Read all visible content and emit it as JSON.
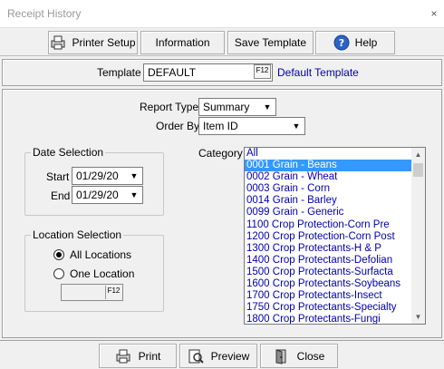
{
  "window": {
    "title": "Receipt History",
    "close_glyph": "×"
  },
  "toolbar": {
    "printer_setup_label": "Printer Setup",
    "information_label": "Information",
    "save_template_label": "Save Template",
    "help_label": "Help"
  },
  "template": {
    "label": "Template",
    "value": "DEFAULT",
    "lookup_key": "F12",
    "description": "Default Template"
  },
  "report": {
    "type_label": "Report Type",
    "type_value": "Summary",
    "order_label": "Order By",
    "order_value": "Item ID"
  },
  "date_selection": {
    "title": "Date Selection",
    "start_label": "Start",
    "start_value": "01/29/20",
    "end_label": "End",
    "end_value": "01/29/20"
  },
  "location_selection": {
    "title": "Location Selection",
    "all_label": "All Locations",
    "one_label": "One Location",
    "selected": "all",
    "lookup_key": "F12"
  },
  "category": {
    "label": "Category",
    "items": [
      "All",
      "0001 Grain - Beans",
      "0002 Grain - Wheat",
      "0003 Grain - Corn",
      "0014 Grain - Barley",
      "0099 Grain - Generic",
      "1100 Crop Protection-Corn Pre",
      "1200 Crop Protection-Corn Post",
      "1300 Crop Protectants-H & P",
      "1400 Crop Protectants-Defolian",
      "1500 Crop Protectants-Surfacta",
      "1600 Crop Protectants-Soybeans",
      "1700 Crop Protectants-Insect",
      "1750 Crop Protectants-Specialty",
      "1800 Crop Protectants-Fungi"
    ],
    "selected_index": 1
  },
  "bottom": {
    "print_label": "Print",
    "preview_label": "Preview",
    "close_label": "Close"
  },
  "colors": {
    "selection": "#3399ff",
    "link_text": "#0000b0"
  }
}
